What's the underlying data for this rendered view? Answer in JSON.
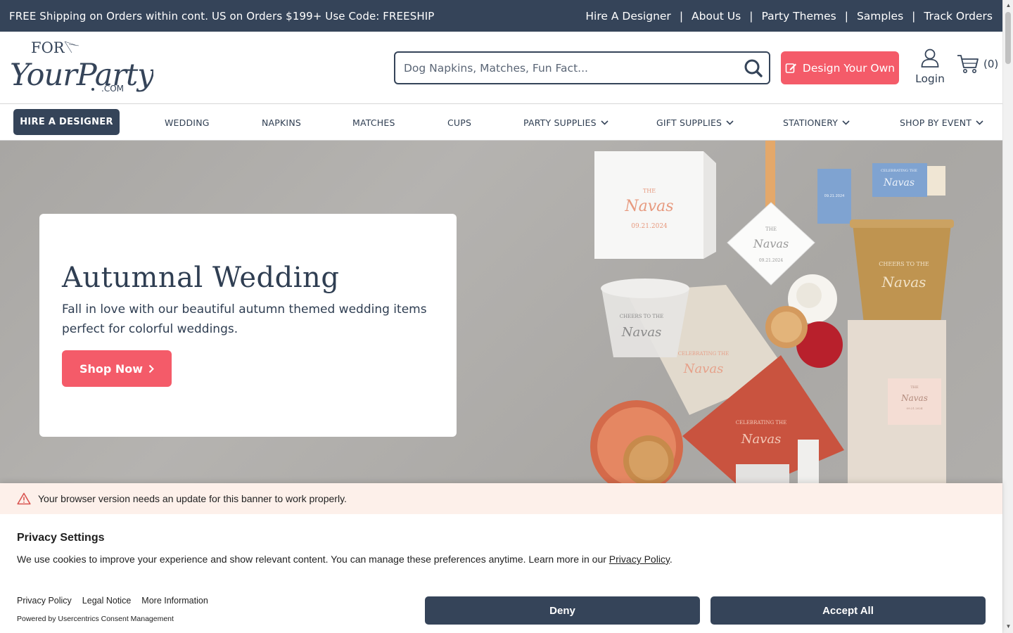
{
  "topbar": {
    "promo": "FREE Shipping on Orders within cont. US on Orders $199+ Use Code: FREESHIP",
    "links": [
      "Hire A Designer",
      "About Us",
      "Party Themes",
      "Samples",
      "Track Orders"
    ],
    "separator": "|"
  },
  "logo": {
    "line1": "FOR",
    "line2": "YourParty",
    "line3": ".COM"
  },
  "search": {
    "placeholder": "Dog Napkins, Matches, Fun Fact...",
    "value": "",
    "icon": "search-icon"
  },
  "header": {
    "design_label": "Design Your Own",
    "login_label": "Login",
    "cart_count": "(0)"
  },
  "nav": {
    "hire_label": "HIRE A DESIGNER",
    "items": [
      "WEDDING",
      "NAPKINS",
      "MATCHES",
      "CUPS",
      "PARTY SUPPLIES",
      "GIFT SUPPLIES",
      "STATIONERY",
      "SHOP BY EVENT"
    ]
  },
  "hero": {
    "title": "Autumnal Wedding",
    "text": "Fall in love with our beautiful autumn themed wedding items perfect for colorful weddings.",
    "cta": "Shop Now",
    "art": {
      "box_text": [
        "THE",
        "Navas",
        "09.21.2024"
      ],
      "tag_text": [
        "THE",
        "Navas",
        "09.21.2024"
      ],
      "matchbook_text": [
        "09.21.2024"
      ],
      "matchbox_text": [
        "CELEBRATING THE",
        "Navas"
      ],
      "gold_cup_text": [
        "CHEERS TO THE",
        "Navas"
      ],
      "clear_cup_text": [
        "CHEERS TO THE",
        "Navas"
      ],
      "napkin_text": [
        "CELEBRATING THE",
        "Navas"
      ],
      "red_napkin_text": [
        "CELEBRATING THE",
        "Navas"
      ],
      "small_box_text": [
        "THE",
        "Navas",
        "09.21.2024"
      ]
    }
  },
  "consent": {
    "warning": "Your browser version needs an update for this banner to work properly.",
    "title": "Privacy Settings",
    "desc_before": "We use cookies to improve your experience and show relevant content. You can manage these preferences anytime. Learn more in our ",
    "desc_link": "Privacy Policy",
    "desc_after": ".",
    "links": [
      "Privacy Policy",
      "Legal Notice",
      "More Information"
    ],
    "powered": "Powered by Usercentrics Consent Management",
    "deny": "Deny",
    "accept": "Accept All"
  },
  "colors": {
    "navy": "#354459",
    "coral": "#f45b69",
    "warning_bg": "#fdf0ea"
  }
}
